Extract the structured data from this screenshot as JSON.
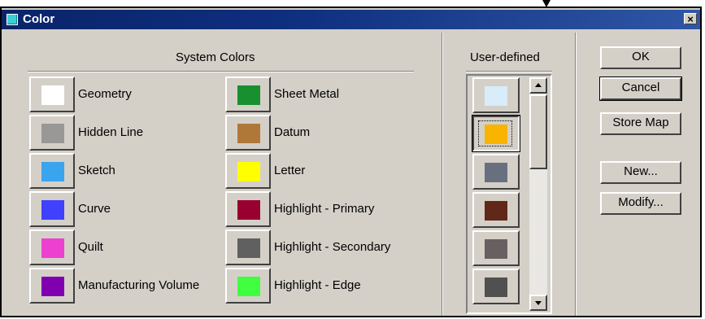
{
  "window": {
    "title": "Color",
    "close_glyph": "×",
    "title_icon": "color-palette-icon",
    "title_icon_color": "#3ad0d8"
  },
  "system_colors": {
    "heading": "System Colors",
    "items": [
      {
        "label": "Geometry",
        "color": "#ffffff"
      },
      {
        "label": "Hidden Line",
        "color": "#9a9896"
      },
      {
        "label": "Sketch",
        "color": "#3aa4ee"
      },
      {
        "label": "Curve",
        "color": "#4040ff"
      },
      {
        "label": "Quilt",
        "color": "#ee40d0"
      },
      {
        "label": "Manufacturing Volume",
        "color": "#8000b0"
      },
      {
        "label": "Sheet Metal",
        "color": "#189030"
      },
      {
        "label": "Datum",
        "color": "#b07838"
      },
      {
        "label": "Letter",
        "color": "#ffff00"
      },
      {
        "label": "Highlight - Primary",
        "color": "#980030"
      },
      {
        "label": "Highlight - Secondary",
        "color": "#606060"
      },
      {
        "label": "Highlight - Edge",
        "color": "#40ff40"
      }
    ]
  },
  "user_defined": {
    "heading": "User-defined",
    "swatches": [
      {
        "color": "#d8ecfa"
      },
      {
        "color": "#f8b400",
        "selected": true
      },
      {
        "color": "#687080"
      },
      {
        "color": "#602818"
      },
      {
        "color": "#686060"
      },
      {
        "color": "#505050"
      }
    ]
  },
  "buttons": {
    "ok": "OK",
    "cancel": "Cancel",
    "store_map": "Store Map",
    "new": "New...",
    "modify": "Modify..."
  }
}
